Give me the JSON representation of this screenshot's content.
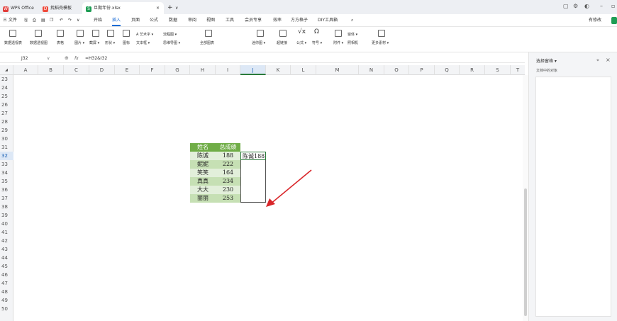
{
  "titlebar": {
    "tabs": [
      {
        "label": "WPS Office",
        "icon": "wps-logo-icon"
      },
      {
        "label": "找稻壳模板",
        "icon": "docer-icon"
      },
      {
        "label": "旦期年份.xlsx",
        "icon": "spreadsheet-file-icon"
      }
    ],
    "new_tab": "+",
    "tab_more": "∨",
    "close_tab": "×"
  },
  "menubar": {
    "file": "三 文件",
    "items": [
      "开始",
      "插入",
      "页面",
      "公式",
      "数据",
      "审阅",
      "视图",
      "工具",
      "会员专享",
      "效率",
      "方方格子",
      "DIY工具箱"
    ],
    "active": "插入",
    "share": "有修改"
  },
  "ribbon": {
    "labels": [
      "数据透视表",
      "数据透视图",
      "表格",
      "图片 ▾",
      "截屏 ▾",
      "形状 ▾",
      "图标",
      "A 艺术字 ▾",
      "流程图 ▾",
      "文本框 ▾",
      "思维导图 ▾",
      "全部图表",
      "迷你图 ▾",
      "超链接",
      "公式 ▾",
      "符号 ▾",
      "附件 ▾",
      "窗体 ▾",
      "照相机",
      "更多素材 ▾"
    ]
  },
  "formulabar": {
    "name_box": "J32",
    "fx": "fx",
    "formula": "=H32&I32"
  },
  "columns": [
    "A",
    "B",
    "C",
    "D",
    "E",
    "F",
    "G",
    "H",
    "I",
    "J",
    "K",
    "L",
    "M",
    "N",
    "O",
    "P",
    "Q",
    "R",
    "S",
    "T"
  ],
  "selected_column": "J",
  "rows": [
    "23",
    "24",
    "25",
    "26",
    "27",
    "28",
    "29",
    "30",
    "31",
    "32",
    "33",
    "34",
    "35",
    "36",
    "37",
    "38",
    "39",
    "40",
    "41",
    "42",
    "43",
    "44",
    "45",
    "46",
    "47",
    "48",
    "49",
    "50"
  ],
  "selected_row": "32",
  "table": {
    "headers": [
      "姓名",
      "总成绩"
    ],
    "rows": [
      {
        "name": "陈诚",
        "score": "188"
      },
      {
        "name": "妮妮",
        "score": "222"
      },
      {
        "name": "笑笑",
        "score": "164"
      },
      {
        "name": "真真",
        "score": "234"
      },
      {
        "name": "大大",
        "score": "230"
      },
      {
        "name": "丽丽",
        "score": "253"
      }
    ],
    "j_result": "陈诚188"
  },
  "colors": {
    "header_green": "#70ad47",
    "row_light": "#e2efda",
    "row_mid": "#c6e0b4",
    "arrow_red": "#d9262a"
  },
  "panel": {
    "title": "选择窗格 ▾",
    "subtitle": "文档中的对象"
  }
}
